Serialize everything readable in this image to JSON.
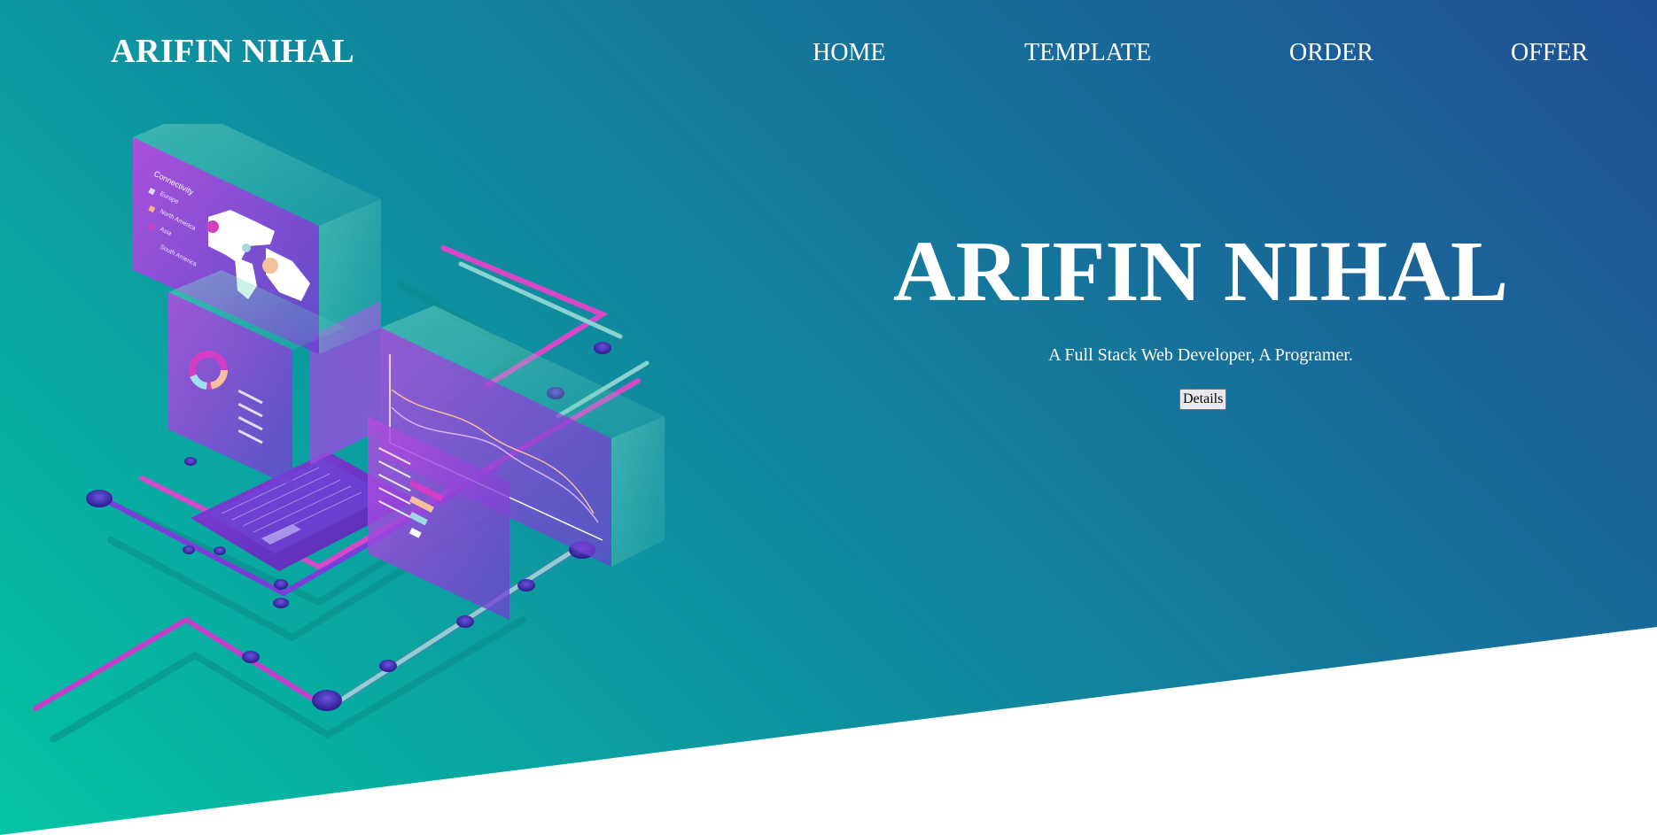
{
  "header": {
    "logo": "ARIFIN NIHAL",
    "nav": [
      "HOME",
      "TEMPLATE",
      "ORDER",
      "OFFER"
    ]
  },
  "hero": {
    "title": "ARIFIN NIHAL",
    "subtitle": "A Full Stack Web Developer, A Programer.",
    "button_label": "Details"
  },
  "illustration": {
    "connectivity_panel": {
      "title": "Connectivity",
      "legend": [
        "Europe",
        "North America",
        "Asia",
        "South America"
      ]
    },
    "icon": "isometric-dashboard-laptop-illustration"
  },
  "colors": {
    "gradient_start": "#03c4a4",
    "gradient_end": "#1f4f93",
    "accent_purple": "#8a3fd6",
    "accent_pink": "#d43ec4",
    "text": "#ffffff"
  }
}
